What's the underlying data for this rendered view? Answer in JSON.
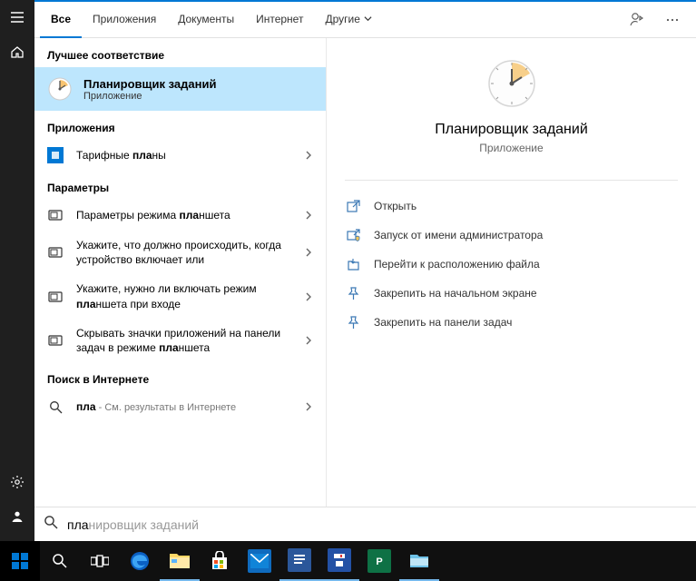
{
  "tabs": {
    "all": "Все",
    "apps": "Приложения",
    "docs": "Документы",
    "web": "Интернет",
    "more": "Другие"
  },
  "groups": {
    "best": "Лучшее соответствие",
    "apps": "Приложения",
    "settings": "Параметры",
    "web": "Поиск в Интернете"
  },
  "bestMatch": {
    "title": "Планировщик заданий",
    "sub": "Приложение"
  },
  "appResults": [
    {
      "pre": "Тарифные ",
      "hl": "пла",
      "post": "ны"
    }
  ],
  "settingResults": [
    {
      "pre": "Параметры режима ",
      "hl": "пла",
      "post": "ншета"
    },
    {
      "pre": "Укажите, что должно происходить, когда устройство включает или",
      "hl": "",
      "post": ""
    },
    {
      "pre": "Укажите, нужно ли включать режим ",
      "hl": "пла",
      "post": "ншета при входе"
    },
    {
      "pre": "Скрывать значки приложений на панели задач в режиме ",
      "hl": "пла",
      "post": "ншета"
    }
  ],
  "webResult": {
    "hl": "пла",
    "sub": " - См. результаты в Интернете"
  },
  "preview": {
    "title": "Планировщик заданий",
    "sub": "Приложение",
    "actions": {
      "open": "Открыть",
      "runAdmin": "Запуск от имени администратора",
      "fileLoc": "Перейти к расположению файла",
      "pinStart": "Закрепить на начальном экране",
      "pinTaskbar": "Закрепить на панели задач"
    }
  },
  "searchBox": {
    "typed": "пла",
    "ghost": "нировщик заданий"
  }
}
